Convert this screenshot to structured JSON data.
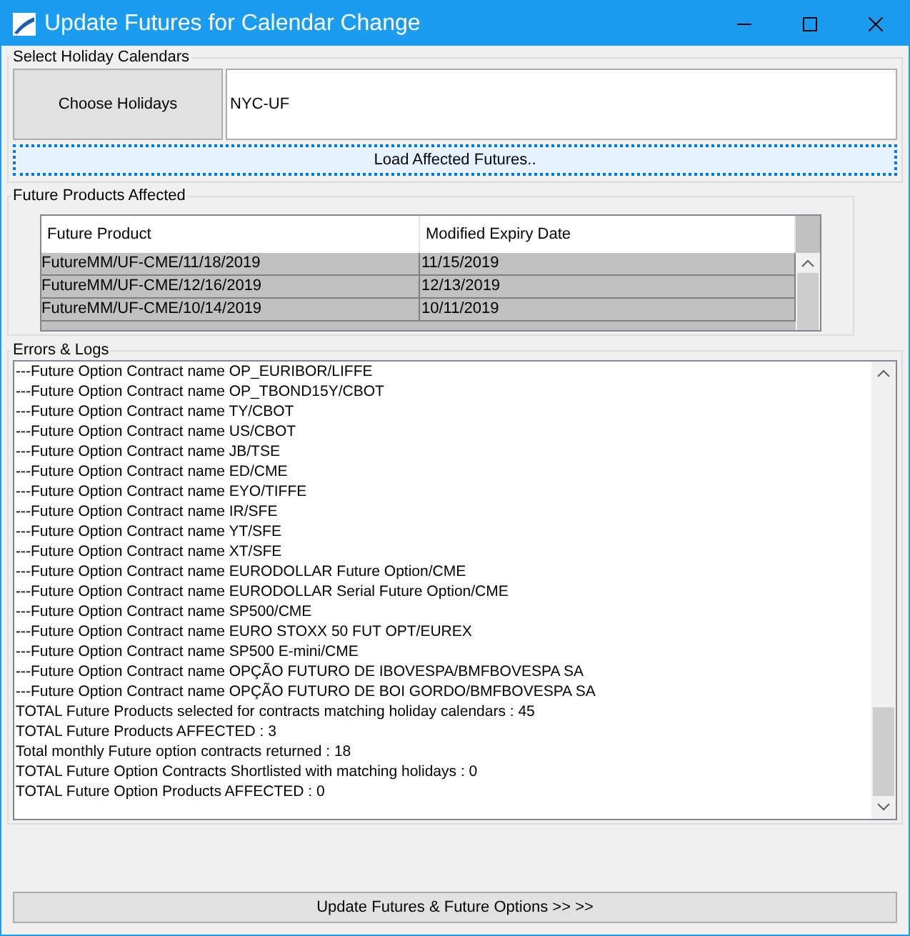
{
  "window": {
    "title": "Update Futures for Calendar Change"
  },
  "holiday_group": {
    "title": "Select Holiday Calendars",
    "choose_button": "Choose Holidays",
    "calendars_value": "NYC-UF",
    "load_button": "Load Affected Futures.."
  },
  "products_group": {
    "title": "Future Products Affected",
    "table": {
      "columns": [
        "Future Product",
        "Modified Expiry Date"
      ],
      "rows": [
        {
          "cells": [
            "FutureMM/UF-CME/11/18/2019",
            "11/15/2019"
          ],
          "selected": true
        },
        {
          "cells": [
            "FutureMM/UF-CME/12/16/2019",
            "12/13/2019"
          ],
          "selected": true
        },
        {
          "cells": [
            "FutureMM/UF-CME/10/14/2019",
            "10/11/2019"
          ],
          "selected": true
        }
      ]
    }
  },
  "logs_group": {
    "title": "Errors & Logs",
    "lines": [
      "---Future Option Contract name OP_EURIBOR/LIFFE",
      "---Future Option Contract name OP_TBOND15Y/CBOT",
      "---Future Option Contract name TY/CBOT",
      "---Future Option Contract name US/CBOT",
      "---Future Option Contract name JB/TSE",
      "---Future Option Contract name ED/CME",
      "---Future Option Contract name EYO/TIFFE",
      "---Future Option Contract name IR/SFE",
      "---Future Option Contract name YT/SFE",
      "---Future Option Contract name XT/SFE",
      "---Future Option Contract name EURODOLLAR Future Option/CME",
      "---Future Option Contract name EURODOLLAR Serial Future Option/CME",
      "---Future Option Contract name SP500/CME",
      "---Future Option Contract name EURO STOXX 50 FUT OPT/EUREX",
      "---Future Option Contract name SP500 E-mini/CME",
      "---Future Option Contract name OPÇÃO FUTURO DE IBOVESPA/BMFBOVESPA SA",
      "---Future Option Contract name OPÇÃO FUTURO DE BOI GORDO/BMFBOVESPA SA",
      "TOTAL Future Products selected for contracts matching holiday calendars : 45",
      "TOTAL Future Products AFFECTED : 3",
      "Total monthly Future option contracts returned : 18",
      "TOTAL Future Option Contracts Shortlisted with matching holidays : 0",
      "TOTAL Future Option Products AFFECTED : 0"
    ]
  },
  "update_button": "Update Futures & Future Options >> >>"
}
